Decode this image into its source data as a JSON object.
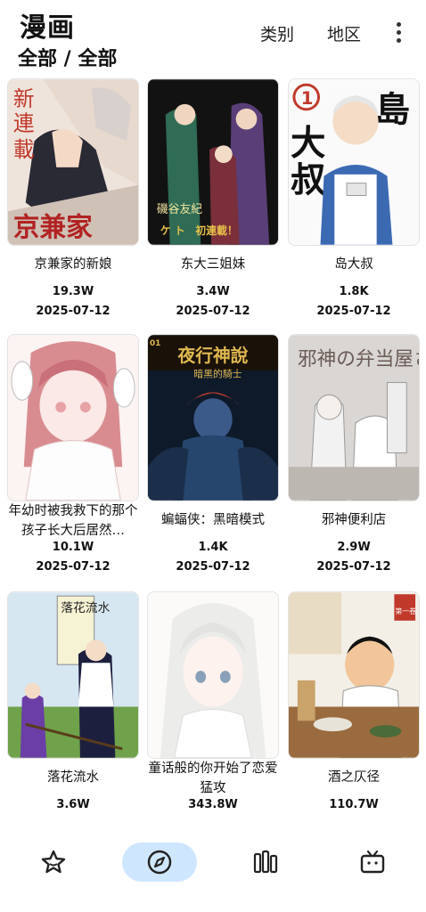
{
  "header": {
    "title": "漫画",
    "filter": "全部 / 全部",
    "category_label": "类别",
    "region_label": "地区"
  },
  "comics": [
    {
      "title": "京兼家的新娘",
      "views": "19.3W",
      "date": "2025-07-12"
    },
    {
      "title": "东大三姐妹",
      "views": "3.4W",
      "date": "2025-07-12"
    },
    {
      "title": "岛大叔",
      "views": "1.8K",
      "date": "2025-07-12"
    },
    {
      "title": "年幼时被我救下的那个孩子长大后居然…",
      "views": "10.1W",
      "date": "2025-07-12"
    },
    {
      "title": "蝙蝠侠：黑暗模式",
      "views": "1.4K",
      "date": "2025-07-12"
    },
    {
      "title": "邪神便利店",
      "views": "2.9W",
      "date": "2025-07-12"
    },
    {
      "title": "落花流水",
      "views": "3.6W",
      "date": ""
    },
    {
      "title": "童话般的你开始了恋爱猛攻",
      "views": "343.8W",
      "date": ""
    },
    {
      "title": "酒之仄径",
      "views": "110.7W",
      "date": ""
    }
  ],
  "covers": {
    "c0": {
      "line1": "新",
      "line2": "連",
      "line3": "載",
      "name": "京兼家"
    },
    "c1": {
      "name": "磯谷友紀",
      "tag": "ケ ト　初連載！"
    },
    "c2": {
      "badge": "1",
      "big1": "島",
      "big2": "大",
      "big3": "叔"
    },
    "c4": {
      "badge": "01",
      "name": "夜行神說",
      "sub": "暗黑的騎士"
    },
    "c5": {
      "name": "邪神の弁当屋さん"
    },
    "c6": {
      "name": "落花流水"
    },
    "c8": {
      "badge": "第一卷"
    }
  },
  "nav": [
    {
      "icon": "star-icon"
    },
    {
      "icon": "compass-icon",
      "active": true
    },
    {
      "icon": "library-icon"
    },
    {
      "icon": "tv-icon"
    }
  ]
}
